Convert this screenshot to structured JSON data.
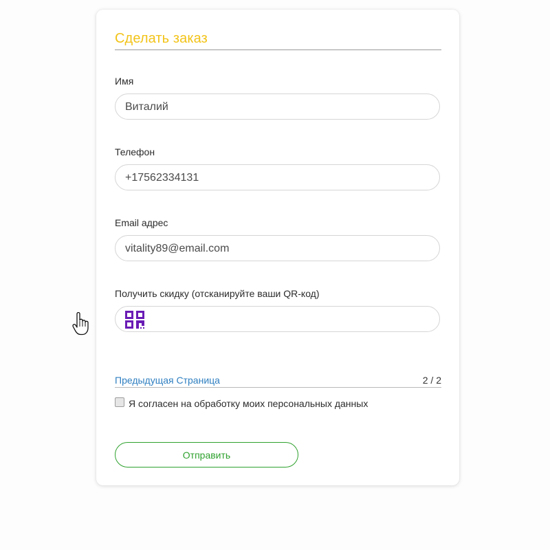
{
  "form": {
    "title": "Сделать заказ",
    "fields": [
      {
        "label": "Имя",
        "value": "Виталий"
      },
      {
        "label": "Телефон",
        "value": "+17562334131"
      },
      {
        "label": "Email адрес",
        "value": "vitality89@email.com"
      },
      {
        "label": "Получить скидку (отсканируйте ваши QR-код)",
        "value": ""
      }
    ],
    "qr_icon": "qr-code-icon",
    "pager": {
      "prev_label": "Предыдущая Страница",
      "page": "2 / 2"
    },
    "consent": {
      "label": "Я согласен на обработку моих персональных данных",
      "checked": false
    },
    "submit_label": "Отправить"
  },
  "colors": {
    "title": "#f2c318",
    "link": "#2f7fc1",
    "submit": "#2ea12e",
    "qr": "#6a1bb5"
  }
}
